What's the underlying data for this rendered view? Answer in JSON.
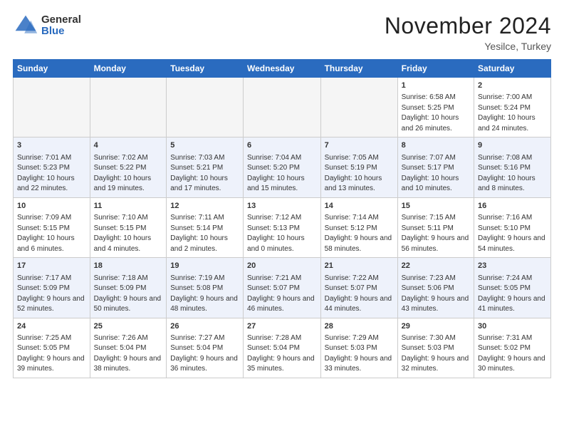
{
  "header": {
    "logo_general": "General",
    "logo_blue": "Blue",
    "month_title": "November 2024",
    "location": "Yesilce, Turkey"
  },
  "days_of_week": [
    "Sunday",
    "Monday",
    "Tuesday",
    "Wednesday",
    "Thursday",
    "Friday",
    "Saturday"
  ],
  "weeks": [
    [
      {
        "day": "",
        "empty": true
      },
      {
        "day": "",
        "empty": true
      },
      {
        "day": "",
        "empty": true
      },
      {
        "day": "",
        "empty": true
      },
      {
        "day": "",
        "empty": true
      },
      {
        "day": "1",
        "sunrise": "6:58 AM",
        "sunset": "5:25 PM",
        "daylight": "10 hours and 26 minutes."
      },
      {
        "day": "2",
        "sunrise": "7:00 AM",
        "sunset": "5:24 PM",
        "daylight": "10 hours and 24 minutes."
      }
    ],
    [
      {
        "day": "3",
        "sunrise": "7:01 AM",
        "sunset": "5:23 PM",
        "daylight": "10 hours and 22 minutes."
      },
      {
        "day": "4",
        "sunrise": "7:02 AM",
        "sunset": "5:22 PM",
        "daylight": "10 hours and 19 minutes."
      },
      {
        "day": "5",
        "sunrise": "7:03 AM",
        "sunset": "5:21 PM",
        "daylight": "10 hours and 17 minutes."
      },
      {
        "day": "6",
        "sunrise": "7:04 AM",
        "sunset": "5:20 PM",
        "daylight": "10 hours and 15 minutes."
      },
      {
        "day": "7",
        "sunrise": "7:05 AM",
        "sunset": "5:19 PM",
        "daylight": "10 hours and 13 minutes."
      },
      {
        "day": "8",
        "sunrise": "7:07 AM",
        "sunset": "5:17 PM",
        "daylight": "10 hours and 10 minutes."
      },
      {
        "day": "9",
        "sunrise": "7:08 AM",
        "sunset": "5:16 PM",
        "daylight": "10 hours and 8 minutes."
      }
    ],
    [
      {
        "day": "10",
        "sunrise": "7:09 AM",
        "sunset": "5:15 PM",
        "daylight": "10 hours and 6 minutes."
      },
      {
        "day": "11",
        "sunrise": "7:10 AM",
        "sunset": "5:15 PM",
        "daylight": "10 hours and 4 minutes."
      },
      {
        "day": "12",
        "sunrise": "7:11 AM",
        "sunset": "5:14 PM",
        "daylight": "10 hours and 2 minutes."
      },
      {
        "day": "13",
        "sunrise": "7:12 AM",
        "sunset": "5:13 PM",
        "daylight": "10 hours and 0 minutes."
      },
      {
        "day": "14",
        "sunrise": "7:14 AM",
        "sunset": "5:12 PM",
        "daylight": "9 hours and 58 minutes."
      },
      {
        "day": "15",
        "sunrise": "7:15 AM",
        "sunset": "5:11 PM",
        "daylight": "9 hours and 56 minutes."
      },
      {
        "day": "16",
        "sunrise": "7:16 AM",
        "sunset": "5:10 PM",
        "daylight": "9 hours and 54 minutes."
      }
    ],
    [
      {
        "day": "17",
        "sunrise": "7:17 AM",
        "sunset": "5:09 PM",
        "daylight": "9 hours and 52 minutes."
      },
      {
        "day": "18",
        "sunrise": "7:18 AM",
        "sunset": "5:09 PM",
        "daylight": "9 hours and 50 minutes."
      },
      {
        "day": "19",
        "sunrise": "7:19 AM",
        "sunset": "5:08 PM",
        "daylight": "9 hours and 48 minutes."
      },
      {
        "day": "20",
        "sunrise": "7:21 AM",
        "sunset": "5:07 PM",
        "daylight": "9 hours and 46 minutes."
      },
      {
        "day": "21",
        "sunrise": "7:22 AM",
        "sunset": "5:07 PM",
        "daylight": "9 hours and 44 minutes."
      },
      {
        "day": "22",
        "sunrise": "7:23 AM",
        "sunset": "5:06 PM",
        "daylight": "9 hours and 43 minutes."
      },
      {
        "day": "23",
        "sunrise": "7:24 AM",
        "sunset": "5:05 PM",
        "daylight": "9 hours and 41 minutes."
      }
    ],
    [
      {
        "day": "24",
        "sunrise": "7:25 AM",
        "sunset": "5:05 PM",
        "daylight": "9 hours and 39 minutes."
      },
      {
        "day": "25",
        "sunrise": "7:26 AM",
        "sunset": "5:04 PM",
        "daylight": "9 hours and 38 minutes."
      },
      {
        "day": "26",
        "sunrise": "7:27 AM",
        "sunset": "5:04 PM",
        "daylight": "9 hours and 36 minutes."
      },
      {
        "day": "27",
        "sunrise": "7:28 AM",
        "sunset": "5:04 PM",
        "daylight": "9 hours and 35 minutes."
      },
      {
        "day": "28",
        "sunrise": "7:29 AM",
        "sunset": "5:03 PM",
        "daylight": "9 hours and 33 minutes."
      },
      {
        "day": "29",
        "sunrise": "7:30 AM",
        "sunset": "5:03 PM",
        "daylight": "9 hours and 32 minutes."
      },
      {
        "day": "30",
        "sunrise": "7:31 AM",
        "sunset": "5:02 PM",
        "daylight": "9 hours and 30 minutes."
      }
    ]
  ]
}
